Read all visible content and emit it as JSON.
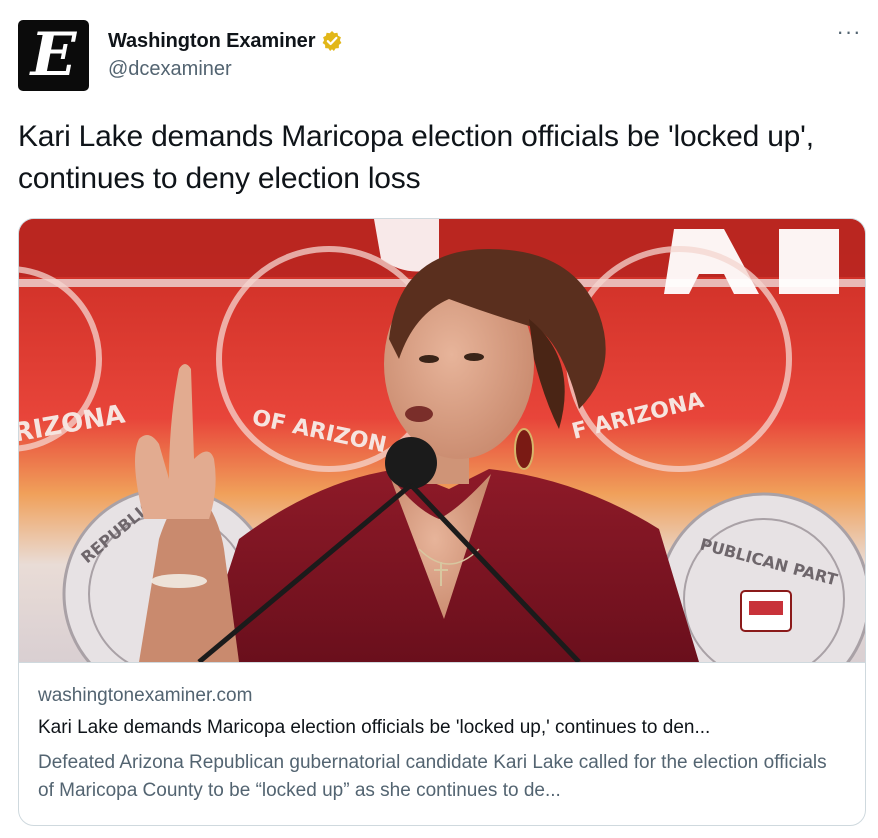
{
  "account": {
    "name": "Washington Examiner",
    "handle": "@dcexaminer",
    "avatar_letter": "E",
    "verified_badge_color": "#e2b719"
  },
  "tweet": {
    "text": "Kari Lake demands Maricopa election officials be 'locked up', continues to deny election loss"
  },
  "more_options": "···",
  "card": {
    "domain": "washingtonexaminer.com",
    "title": "Kari Lake demands Maricopa election officials be 'locked up,' continues to den...",
    "description": "Defeated Arizona Republican gubernatorial candidate Kari Lake called for the election officials of Maricopa County to be “locked up” as she continues to de...",
    "image_text_left": "RIZONA",
    "image_text_mid": "OF ARIZON",
    "image_text_right": "F ARIZONA",
    "image_text_bl": "REPUBLICAN PA",
    "image_text_br": "PUBLICAN PART"
  },
  "colors": {
    "text_primary": "#0f1419",
    "text_secondary": "#536471",
    "border": "#cfd9de",
    "backdrop_red": "#d9322b",
    "dress": "#7a1420"
  }
}
